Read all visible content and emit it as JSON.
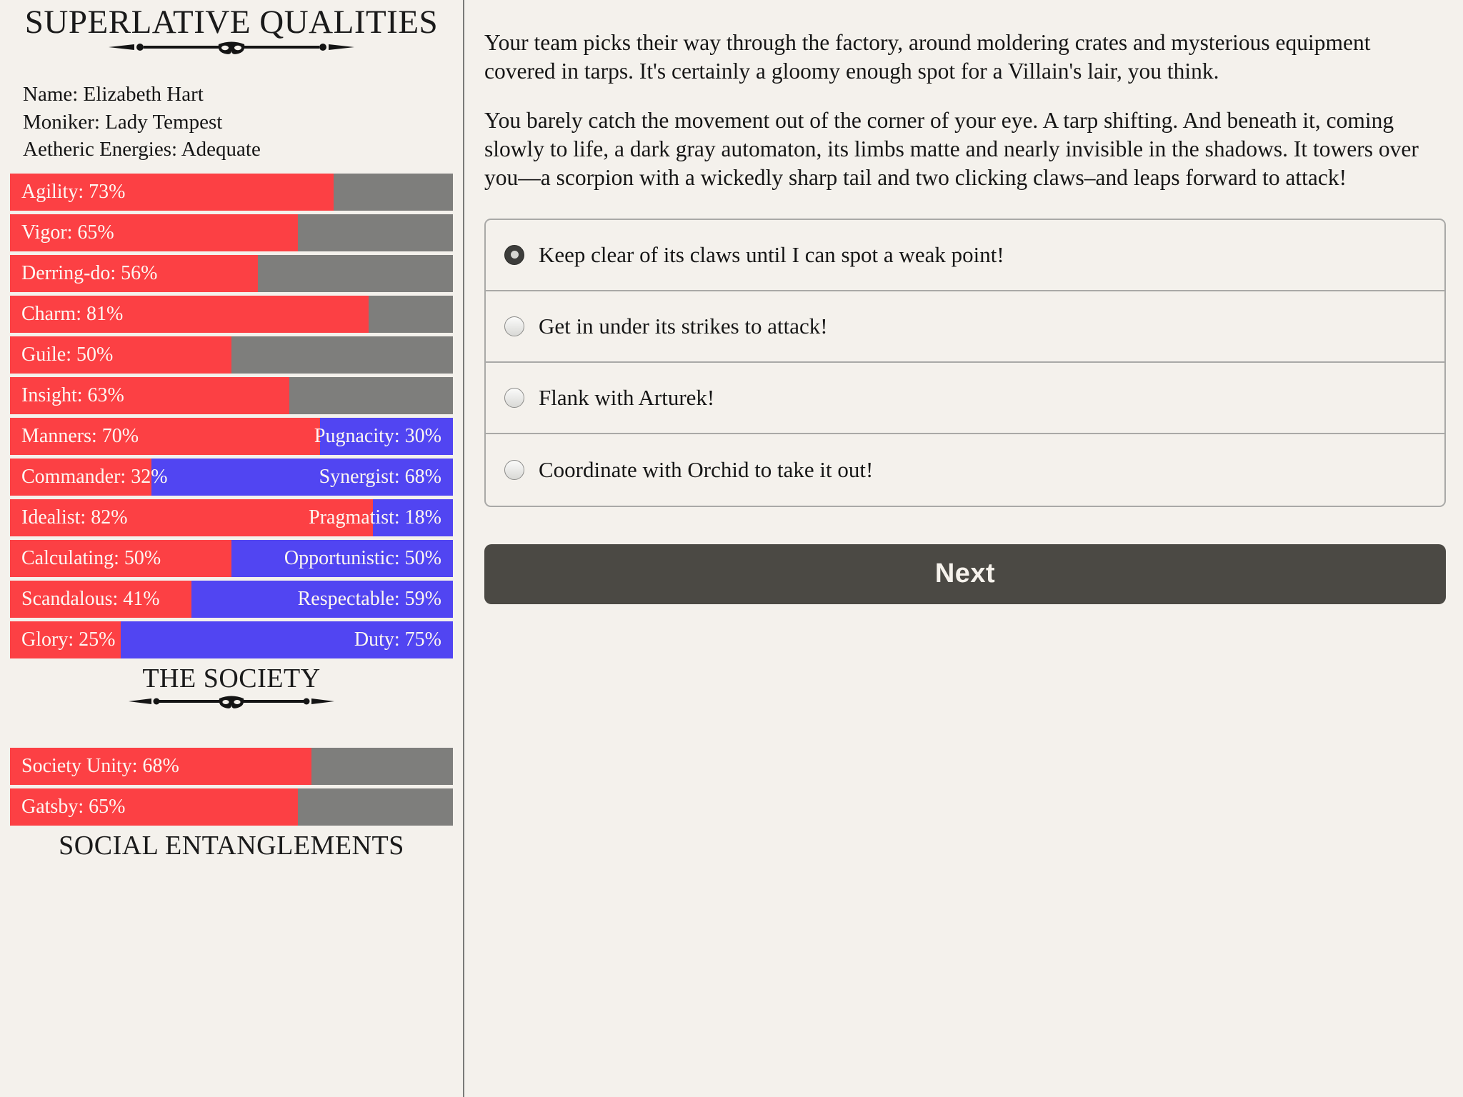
{
  "theme": {
    "background": "#f4f1ec",
    "bar_track": "#7e7e7c",
    "bar_red": "#fc4044",
    "bar_blue": "#5145f2",
    "text": "#161616",
    "button": "#4b4944"
  },
  "stats_panel": {
    "title": "SUPERLATIVE QUALITIES",
    "divider_icon": "masquerade-mask-divider",
    "identity": [
      "Name: Elizabeth Hart",
      "Moniker: Lady Tempest",
      "Aetheric Energies: Adequate"
    ],
    "qualities": [
      {
        "label": "Agility: 73%",
        "value": 73
      },
      {
        "label": "Vigor: 65%",
        "value": 65
      },
      {
        "label": "Derring-do: 56%",
        "value": 56
      },
      {
        "label": "Charm: 81%",
        "value": 81
      },
      {
        "label": "Guile: 50%",
        "value": 50
      },
      {
        "label": "Insight: 63%",
        "value": 63
      }
    ],
    "opposed": [
      {
        "left_label": "Manners: 70%",
        "left_value": 70,
        "right_label": "Pugnacity: 30%",
        "right_value": 30
      },
      {
        "left_label": "Commander: 32%",
        "left_value": 32,
        "right_label": "Synergist: 68%",
        "right_value": 68
      },
      {
        "left_label": "Idealist: 82%",
        "left_value": 82,
        "right_label": "Pragmatist: 18%",
        "right_value": 18
      },
      {
        "left_label": "Calculating: 50%",
        "left_value": 50,
        "right_label": "Opportunistic: 50%",
        "right_value": 50
      },
      {
        "left_label": "Scandalous: 41%",
        "left_value": 41,
        "right_label": "Respectable: 59%",
        "right_value": 59
      },
      {
        "left_label": "Glory: 25%",
        "left_value": 25,
        "right_label": "Duty: 75%",
        "right_value": 75
      }
    ],
    "society": {
      "title": "THE SOCIETY",
      "divider_icon": "masquerade-mask-divider",
      "bars": [
        {
          "label": "Society Unity: 68%",
          "value": 68
        },
        {
          "label": "Gatsby: 65%",
          "value": 65
        }
      ]
    },
    "entanglements": {
      "title": "SOCIAL ENTANGLEMENTS"
    }
  },
  "story": {
    "paragraphs": [
      "Your team picks their way through the factory, around moldering crates and mysterious equipment covered in tarps. It's certainly a gloomy enough spot for a Villain's lair, you think.",
      "You barely catch the movement out of the corner of your eye. A tarp shifting. And beneath it, coming slowly to life, a dark gray automaton, its limbs matte and nearly invisible in the shadows. It towers over you—a scorpion with a wickedly sharp tail and two clicking claws–and leaps forward to attack!"
    ],
    "choices": [
      {
        "label": "Keep clear of its claws until I can spot a weak point!",
        "selected": true
      },
      {
        "label": "Get in under its strikes to attack!",
        "selected": false
      },
      {
        "label": "Flank with Arturek!",
        "selected": false
      },
      {
        "label": "Coordinate with Orchid to take it out!",
        "selected": false
      }
    ],
    "next_label": "Next"
  }
}
